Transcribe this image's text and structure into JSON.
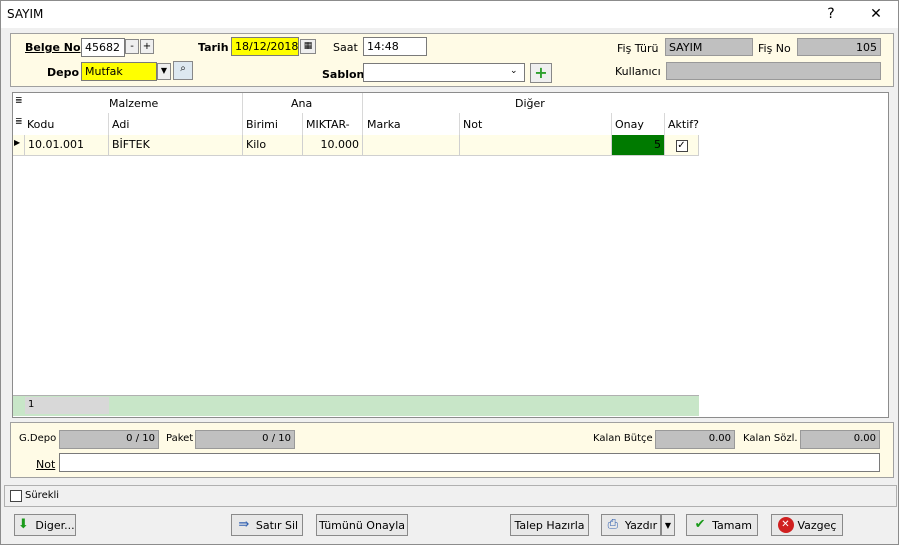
{
  "window": {
    "title": "SAYIM",
    "help": "?",
    "close": "✕"
  },
  "header": {
    "belge_no_label": "Belge No",
    "belge_no_value": "45682",
    "minus": "-",
    "plus": "+",
    "tarih_label": "Tarih",
    "tarih_value": "18/12/2018",
    "saat_label": "Saat",
    "saat_value": "14:48",
    "depo_label": "Depo",
    "depo_value": "Mutfak",
    "sablon_label": "Sablon",
    "sablon_value": "",
    "fis_turu_label": "Fiş Türü",
    "fis_turu_value": "SAYIM",
    "fis_no_label": "Fiş No",
    "fis_no_value": "105",
    "kullanici_label": "Kullanıcı",
    "kullanici_value": ""
  },
  "grid": {
    "groups": [
      "Malzeme",
      "Ana",
      "Diğer"
    ],
    "columns": [
      "Kodu",
      "Adi",
      "Birimi",
      "MIKTAR-",
      "Marka",
      "Not",
      "Onay",
      "Aktif?"
    ],
    "rows": [
      {
        "kodu": "10.01.001",
        "adi": "BİFTEK",
        "birimi": "Kilo",
        "miktar": "10.000",
        "marka": "",
        "not": "",
        "onay": "5",
        "aktif": true
      }
    ],
    "footer_count": "1"
  },
  "bottom": {
    "gdepo_label": "G.Depo",
    "gdepo_value": "0 / 10",
    "paket_label": "Paket",
    "paket_value": "0 / 10",
    "kalan_butce_label": "Kalan Bütçe",
    "kalan_butce_value": "0.00",
    "kalan_sozl_label": "Kalan Sözl.",
    "kalan_sozl_value": "0.00",
    "not_label": "Not",
    "not_value": ""
  },
  "surekli_label": "Sürekli",
  "buttons": {
    "diger": "Diger...",
    "satir_sil": "Satır Sil",
    "tumunu_onayla": "Tümünü Onayla",
    "talep_hazirla": "Talep Hazırla",
    "yazdir": "Yazdır",
    "tamam": "Tamam",
    "vazgec": "Vazgeç"
  },
  "colors": {
    "yellow": "#ffff00",
    "panel": "#fffbe6",
    "onay_green": "#007a00",
    "grid_footer": "#c8e6c8"
  }
}
